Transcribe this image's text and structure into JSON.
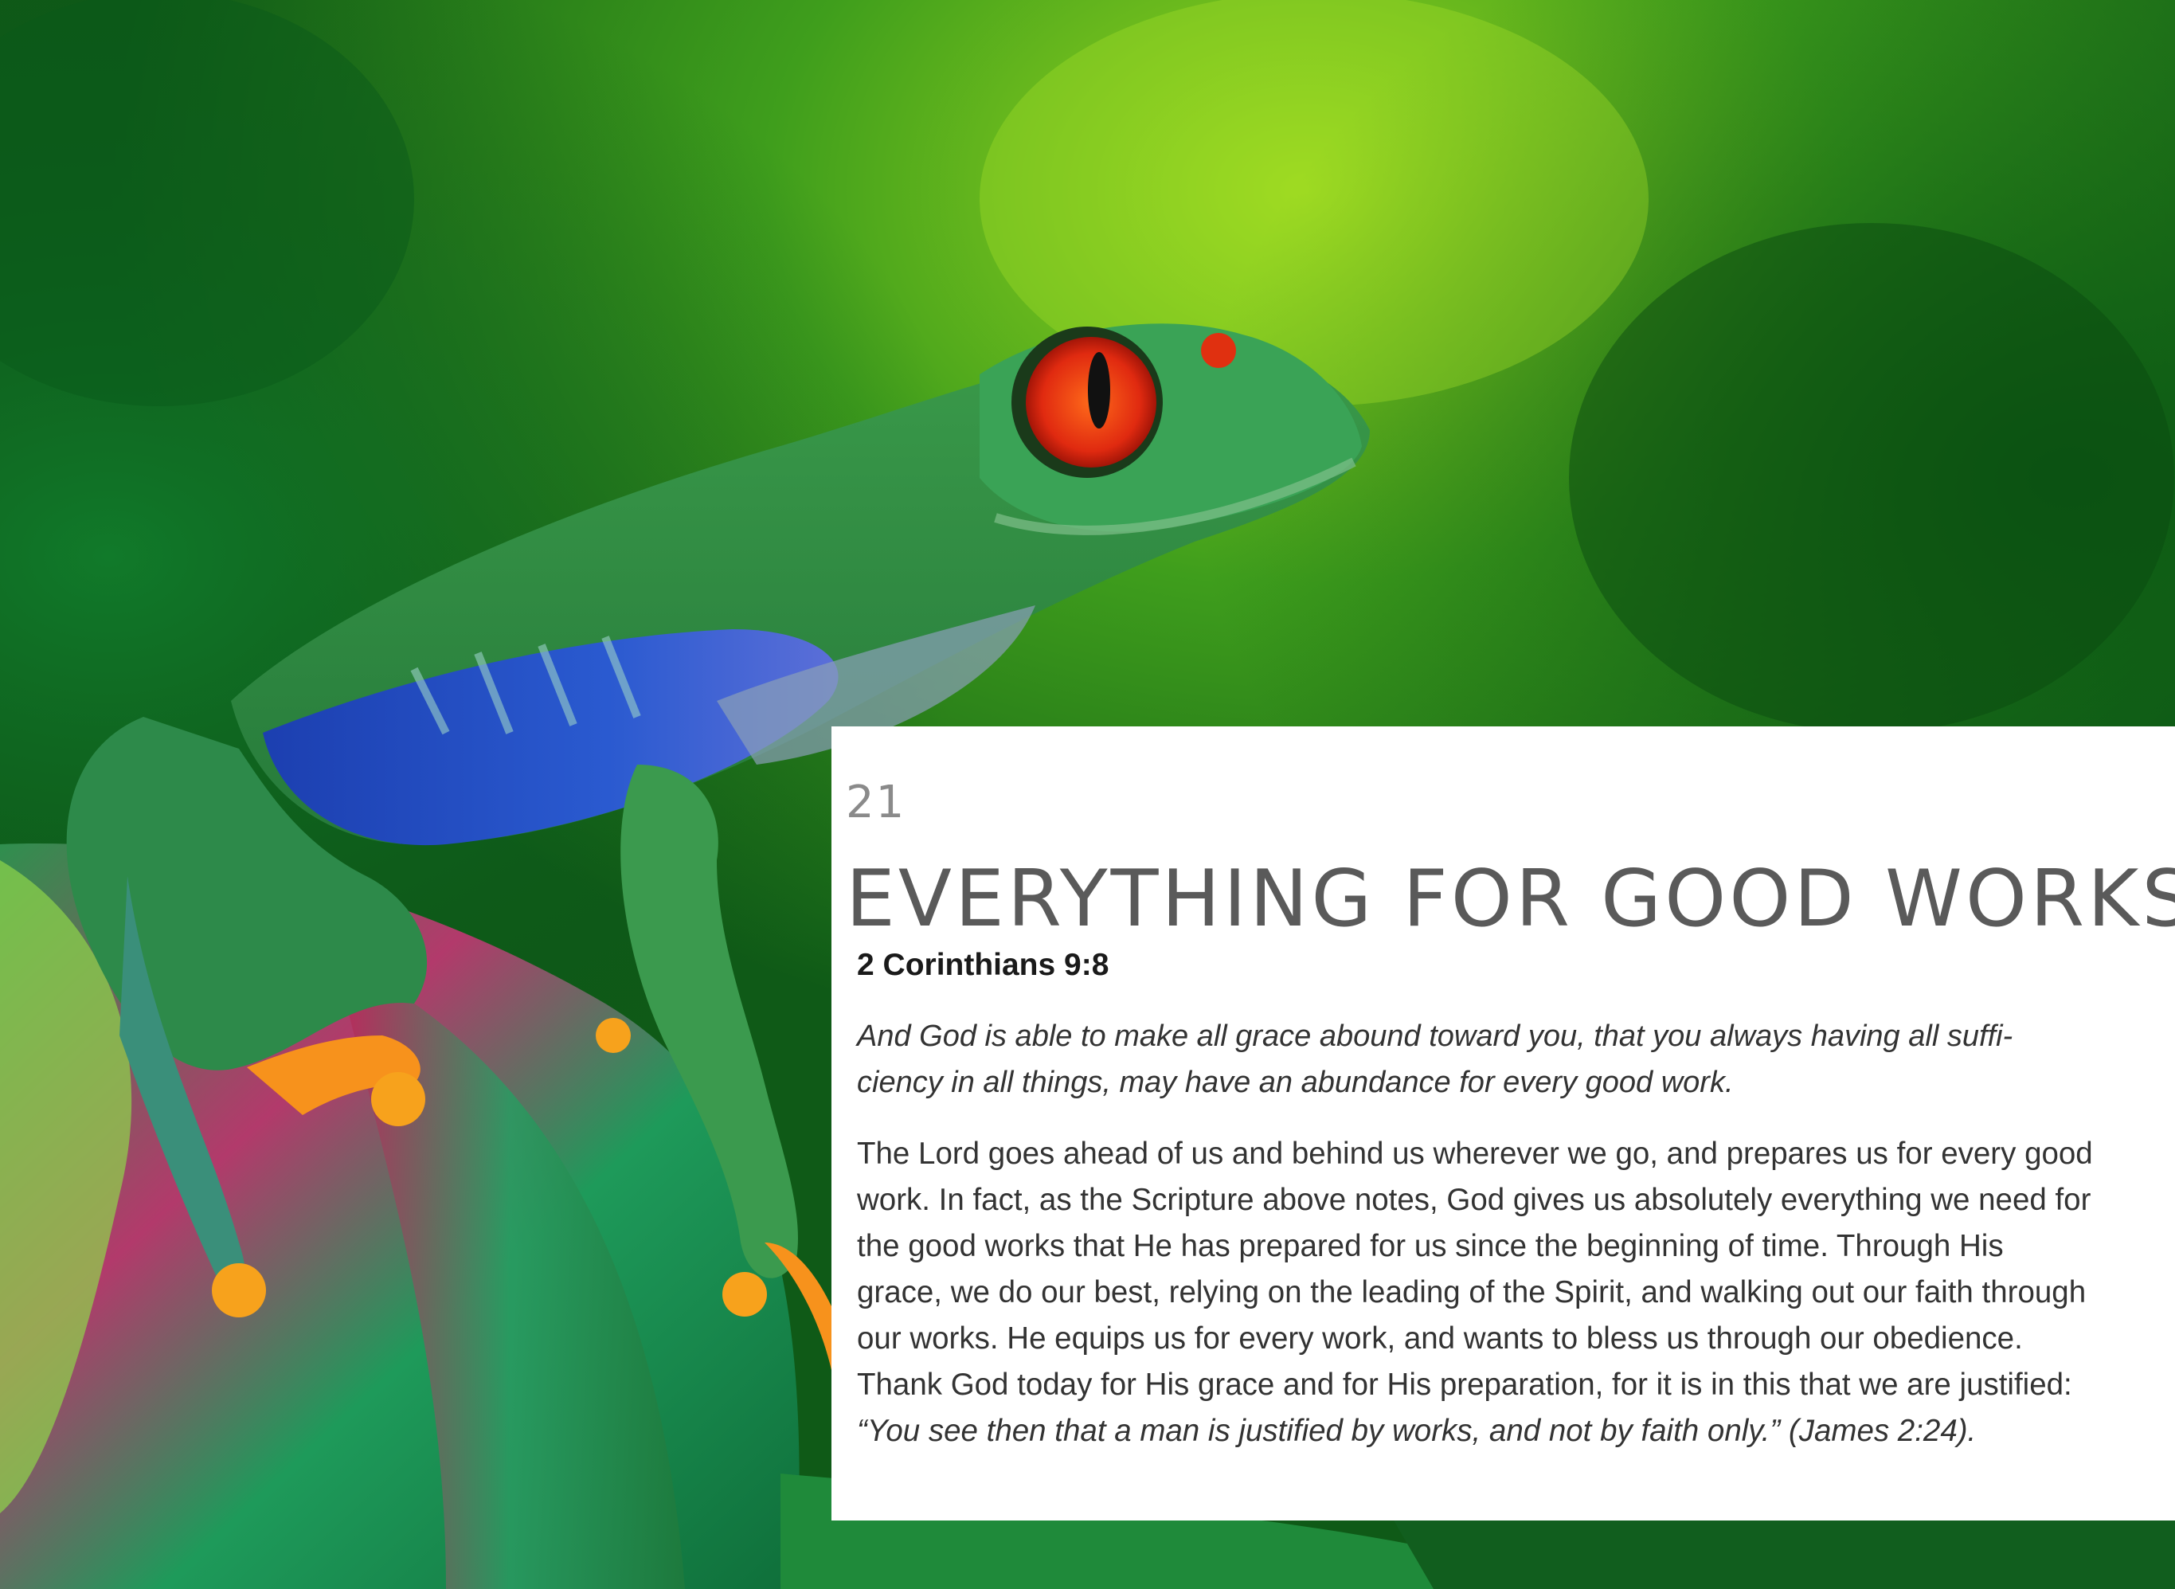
{
  "devotional": {
    "day_number": "21",
    "title": "EVERYTHING FOR GOOD WORKS",
    "scripture_reference": "2 Corinthians 9:8",
    "scripture_text_line1": "And God is able to make all grace abound toward you, that you always having all suffi-",
    "scripture_text_line2": "ciency in all things, may have an abundance for every good work.",
    "body_line1": "The Lord goes ahead of us and behind us wherever we go, and prepares us for every good",
    "body_line2": "work. In fact, as the Scripture above notes, God gives us absolutely everything we need for",
    "body_line3": "the good works that He has prepared for us since the beginning of time. Through His",
    "body_line4": "grace, we do our best, relying on the leading of the Spirit, and walking out our faith through",
    "body_line5": "our works. He equips us for every work, and wants to bless us through our obedience.",
    "body_line6": "Thank God today for His grace and for His preparation, for it is in this that we are justified:",
    "closing_quote": "“You see then that a man is justified by works, and not by faith only.” (James 2:24)."
  },
  "colors": {
    "card_background": "#ffffff",
    "title_color": "#5a5a5a",
    "day_number_color": "#8a8a8a",
    "text_color": "#333333"
  }
}
